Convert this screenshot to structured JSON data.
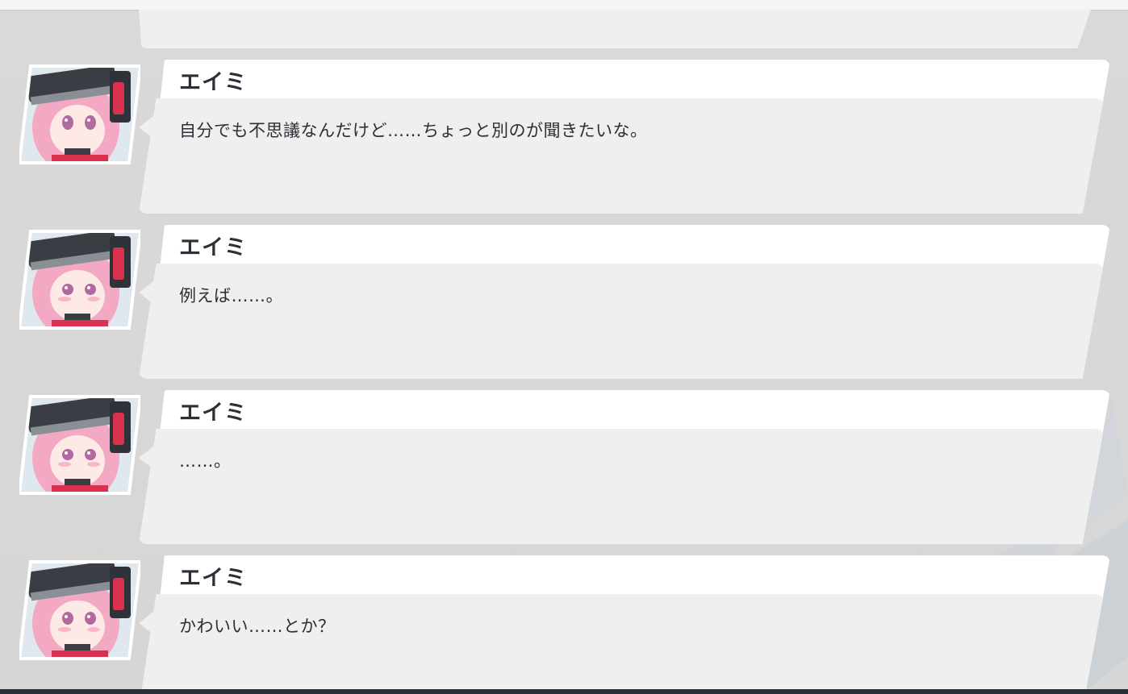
{
  "colors": {
    "panel_bg": "#d8d8d8",
    "name_tab_bg": "#ffffff",
    "bubble_bg": "#efefef",
    "text": "#2b2f36",
    "avatar_hair": "#f3a9c4",
    "avatar_cap": "#3a3d44",
    "avatar_accent": "#d8324f"
  },
  "messages": [
    {
      "speaker": "エイミ",
      "avatar": "character-portrait-icon",
      "text": "自分でも不思議なんだけど……ちょっと別のが聞きたいな。"
    },
    {
      "speaker": "エイミ",
      "avatar": "character-portrait-icon",
      "text": "例えば……。"
    },
    {
      "speaker": "エイミ",
      "avatar": "character-portrait-icon",
      "text": "……。"
    },
    {
      "speaker": "エイミ",
      "avatar": "character-portrait-icon",
      "text": "かわいい……とか？"
    }
  ]
}
